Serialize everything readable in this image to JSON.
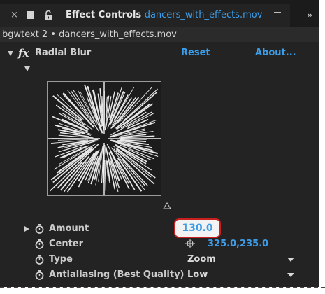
{
  "tab": {
    "close": "×",
    "panel_name": "Effect Controls",
    "file_name": "dancers_with_effects.mov",
    "overflow": "»"
  },
  "subhead": {
    "label": "bgwtext 2 • dancers_with_effects.mov"
  },
  "effect": {
    "fx": "fx",
    "name": "Radial Blur",
    "reset": "Reset",
    "about": "About..."
  },
  "properties": {
    "amount": {
      "label": "Amount",
      "value": "130.0"
    },
    "center": {
      "label": "Center",
      "value": "325.0,235.0"
    },
    "type": {
      "label": "Type",
      "value": "Zoom"
    },
    "antialiasing": {
      "label": "Antialiasing (Best Quality)",
      "value": "Low"
    }
  },
  "colors": {
    "accent": "#3c9eea",
    "highlight_ring": "#c8201f",
    "panel_bg": "#232323"
  },
  "icons": [
    "close-icon",
    "panel-square-icon",
    "lock-icon",
    "panel-menu-icon",
    "overflow-icon",
    "disclosure-triangle-icon",
    "stopwatch-icon",
    "crosshair-icon",
    "dropdown-arrow-icon"
  ]
}
